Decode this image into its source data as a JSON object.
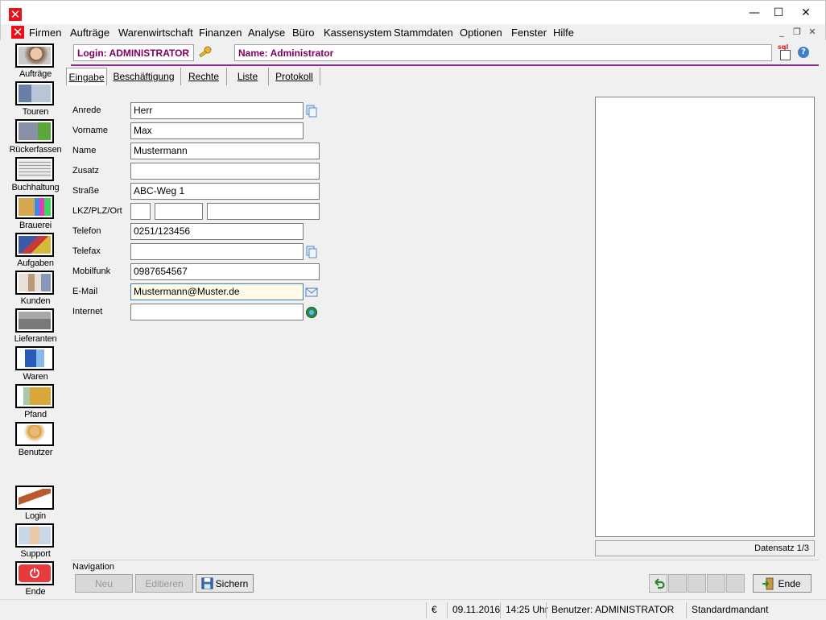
{
  "window": {
    "minimize": "—",
    "maximize": "☐",
    "close": "✕"
  },
  "menu": [
    "Firmen",
    "Aufträge",
    "Warenwirtschaft",
    "Finanzen",
    "Analyse",
    "Büro",
    "Kassensystem",
    "Stammdaten",
    "Optionen",
    "Fenster",
    "Hilfe"
  ],
  "mdi": {
    "minimize": "_",
    "restore": "❐",
    "close": "✕"
  },
  "sidebar": [
    {
      "label": "Aufträge",
      "icon": "operator-icon"
    },
    {
      "label": "Touren",
      "icon": "truck-icon"
    },
    {
      "label": "Rückerfassen",
      "icon": "truck-check-icon"
    },
    {
      "label": "Buchhaltung",
      "icon": "invoice-icon"
    },
    {
      "label": "Brauerei",
      "icon": "brewery-icon"
    },
    {
      "label": "Aufgaben",
      "icon": "tasks-icon"
    },
    {
      "label": "Kunden",
      "icon": "customers-icon"
    },
    {
      "label": "Lieferanten",
      "icon": "suppliers-icon"
    },
    {
      "label": "Waren",
      "icon": "goods-icon"
    },
    {
      "label": "Pfand",
      "icon": "crate-icon"
    },
    {
      "label": "Benutzer",
      "icon": "user-lock-icon"
    },
    {
      "label": "Login",
      "icon": "key-icon"
    },
    {
      "label": "Support",
      "icon": "handshake-icon"
    },
    {
      "label": "Ende",
      "icon": "power-icon"
    }
  ],
  "header": {
    "login": "Login: ADMINISTRATOR",
    "name": "Name: Administrator",
    "sql": "sql",
    "help": "?"
  },
  "tabs": [
    "Eingabe",
    "Beschäftigung",
    "Rechte",
    "Liste",
    "Protokoll"
  ],
  "form": {
    "anrede": {
      "label": "Anrede",
      "value": "Herr"
    },
    "vorname": {
      "label": "Vorname",
      "value": "Max"
    },
    "name": {
      "label": "Name",
      "value": "Mustermann"
    },
    "zusatz": {
      "label": "Zusatz",
      "value": ""
    },
    "strasse": {
      "label": "Straße",
      "value": "ABC-Weg 1"
    },
    "lkz_plz_ort": {
      "label": "LKZ/PLZ/Ort",
      "lkz": "",
      "plz": "",
      "ort": ""
    },
    "telefon": {
      "label": "Telefon",
      "value": "0251/123456"
    },
    "telefax": {
      "label": "Telefax",
      "value": ""
    },
    "mobilfunk": {
      "label": "Mobilfunk",
      "value": "0987654567"
    },
    "email": {
      "label": "E-Mail",
      "value": "Mustermann@Muster.de"
    },
    "internet": {
      "label": "Internet",
      "value": ""
    }
  },
  "record": {
    "label": "Datensatz 1/3"
  },
  "navigation": {
    "label": "Navigation",
    "neu": "Neu",
    "editieren": "Editieren",
    "sichern": "Sichern",
    "ende": "Ende"
  },
  "status": {
    "currency": "€",
    "date": "09.11.2016",
    "time": "14:25 Uhr",
    "user": "Benutzer: ADMINISTRATOR",
    "client": "Standardmandant"
  },
  "colors": {
    "accent": "#800060",
    "divider": "#8a2a8a",
    "close_red": "#e8101a"
  }
}
